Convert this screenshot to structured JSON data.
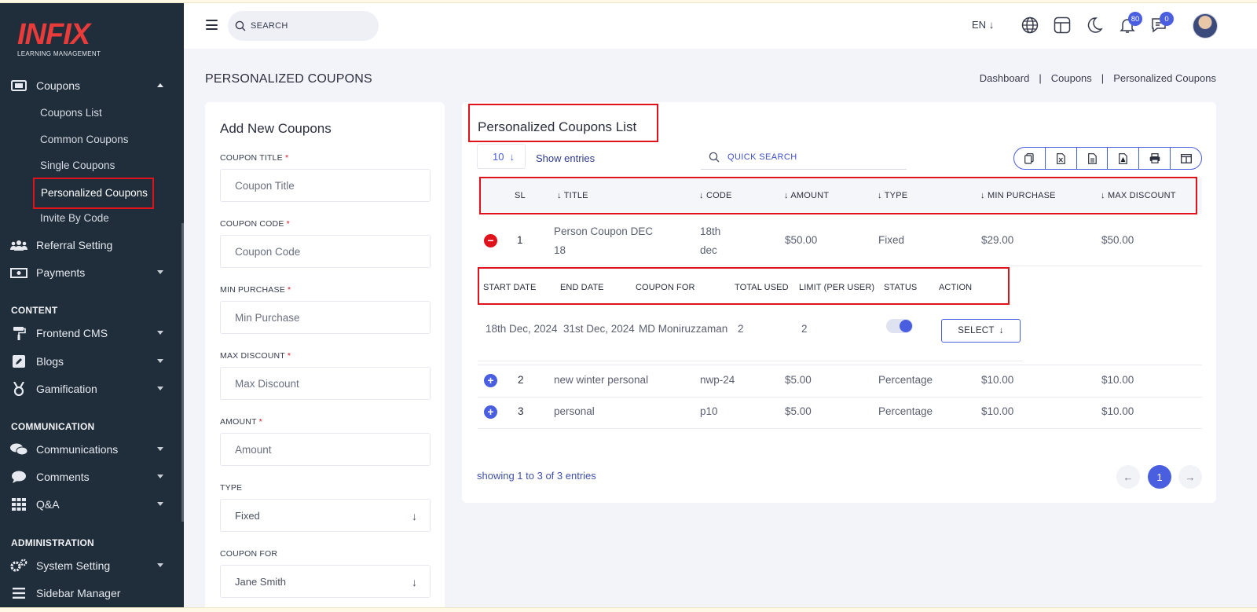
{
  "brand": {
    "name": "INFIX",
    "tagline": "LEARNING MANAGEMENT"
  },
  "sidebar": {
    "coupons": {
      "label": "Coupons"
    },
    "coupons_sub": [
      "Coupons List",
      "Common Coupons",
      "Single Coupons",
      "Personalized Coupons",
      "Invite By Code"
    ],
    "referral": "Referral Setting",
    "payments": "Payments",
    "section_content": "CONTENT",
    "frontend_cms": "Frontend CMS",
    "blogs": "Blogs",
    "gamification": "Gamification",
    "section_communication": "COMMUNICATION",
    "communications": "Communications",
    "comments": "Comments",
    "qa": "Q&A",
    "section_administration": "ADMINISTRATION",
    "system_setting": "System Setting",
    "sidebar_manager": "Sidebar Manager"
  },
  "header": {
    "search_placeholder": "SEARCH",
    "language": "EN",
    "notifications_count": "80",
    "messages_count": "0"
  },
  "page": {
    "title": "PERSONALIZED COUPONS",
    "breadcrumb": [
      "Dashboard",
      "Coupons",
      "Personalized Coupons"
    ]
  },
  "form": {
    "heading": "Add New Coupons",
    "fields": {
      "coupon_title": {
        "label": "COUPON TITLE",
        "placeholder": "Coupon Title"
      },
      "coupon_code": {
        "label": "COUPON CODE",
        "placeholder": "Coupon Code"
      },
      "min_purchase": {
        "label": "MIN PURCHASE",
        "placeholder": "Min Purchase"
      },
      "max_discount": {
        "label": "MAX DISCOUNT",
        "placeholder": "Max Discount"
      },
      "amount": {
        "label": "AMOUNT",
        "placeholder": "Amount"
      },
      "type": {
        "label": "TYPE",
        "value": "Fixed"
      },
      "coupon_for": {
        "label": "COUPON FOR",
        "value": "Jane Smith"
      }
    },
    "required_mark": "*"
  },
  "list": {
    "heading": "Personalized Coupons List",
    "entries": "10",
    "show_entries": "Show entries",
    "quick_search_placeholder": "QUICK SEARCH",
    "columns": {
      "sl": "SL",
      "title": "TITLE",
      "code": "CODE",
      "amount": "AMOUNT",
      "type": "TYPE",
      "min_purchase": "MIN PURCHASE",
      "max_discount": "MAX DISCOUNT"
    },
    "rows": [
      {
        "sl": "1",
        "title_line1": "Person Coupon DEC",
        "title_line2": "18",
        "code_line1": "18th",
        "code_line2": "dec",
        "amount": "$50.00",
        "type": "Fixed",
        "min_purchase": "$29.00",
        "max_discount": "$50.00"
      },
      {
        "sl": "2",
        "title": "new winter personal",
        "code": "nwp-24",
        "amount": "$5.00",
        "type": "Percentage",
        "min_purchase": "$10.00",
        "max_discount": "$10.00"
      },
      {
        "sl": "3",
        "title": "personal",
        "code": "p10",
        "amount": "$5.00",
        "type": "Percentage",
        "min_purchase": "$10.00",
        "max_discount": "$10.00"
      }
    ],
    "detail_columns": {
      "start_date": "START DATE",
      "end_date": "END DATE",
      "coupon_for": "COUPON FOR",
      "total_used": "TOTAL USED",
      "limit": "LIMIT (PER USER)",
      "status": "STATUS",
      "action": "ACTION"
    },
    "detail": {
      "start_date": "18th Dec, 2024",
      "end_date": "31st Dec, 2024",
      "coupon_for": "MD Moniruzzaman",
      "total_used": "2",
      "limit": "2",
      "status_on": true,
      "action_label": "SELECT"
    },
    "footer": "showing 1 to 3 of 3 entries",
    "current_page": "1"
  },
  "colors": {
    "accent": "#4a5ee0",
    "highlight": "#e0121c",
    "sidebar_bg": "#202e3b"
  }
}
